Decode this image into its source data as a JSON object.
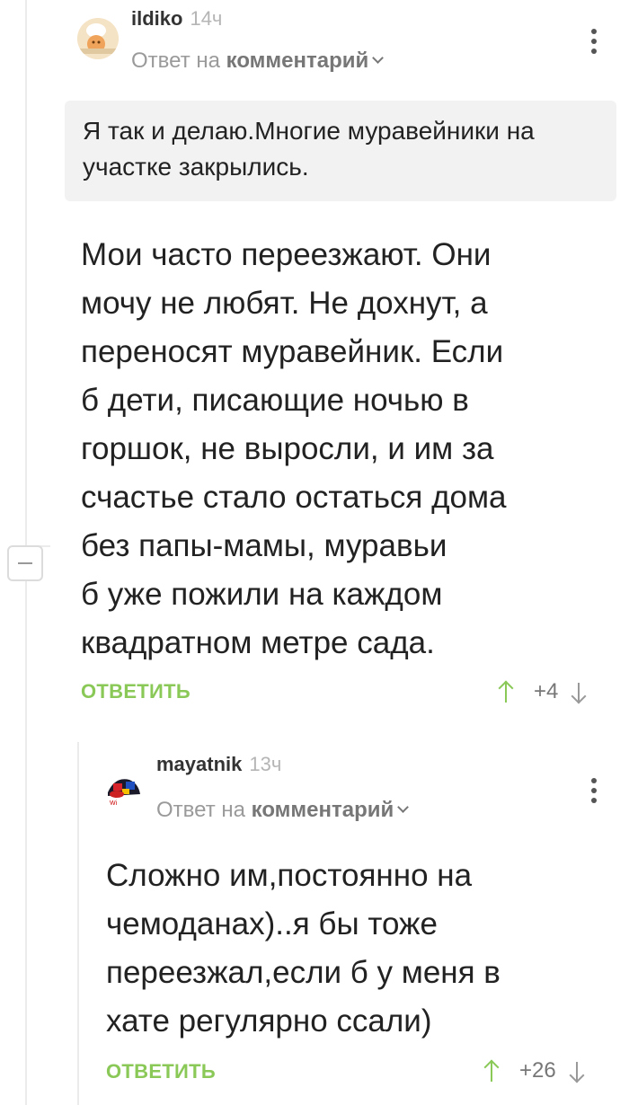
{
  "comments": [
    {
      "username": "ildiko",
      "time": "14ч",
      "reply_prefix": "Ответ на",
      "reply_target": "комментарий",
      "quote": "Я так и делаю.Многие муравейники на участке закрылись.",
      "body_lines": [
        "Мои часто переезжают. Они",
        "мочу не любят. Не дохнут, а",
        "переносят муравейник. Если",
        "б дети, писающие ночью в",
        "горшок, не выросли, и им за",
        "счастье стало остаться дома",
        "без папы-мамы, муравьи",
        "б уже пожили на каждом",
        "квадратном метре сада."
      ],
      "reply_label": "ОТВЕТИТЬ",
      "score": "+4"
    },
    {
      "username": "mayatnik",
      "time": "13ч",
      "reply_prefix": "Ответ на",
      "reply_target": "комментарий",
      "body_lines": [
        "Сложно им,постоянно на",
        "чемоданах)..я бы тоже",
        "переезжал,если б у меня в",
        "хате регулярно ссали)"
      ],
      "reply_label": "ОТВЕТИТЬ",
      "score": "+26"
    }
  ],
  "colors": {
    "accent": "#8ac858",
    "quote_bg": "#f2f2f2"
  }
}
